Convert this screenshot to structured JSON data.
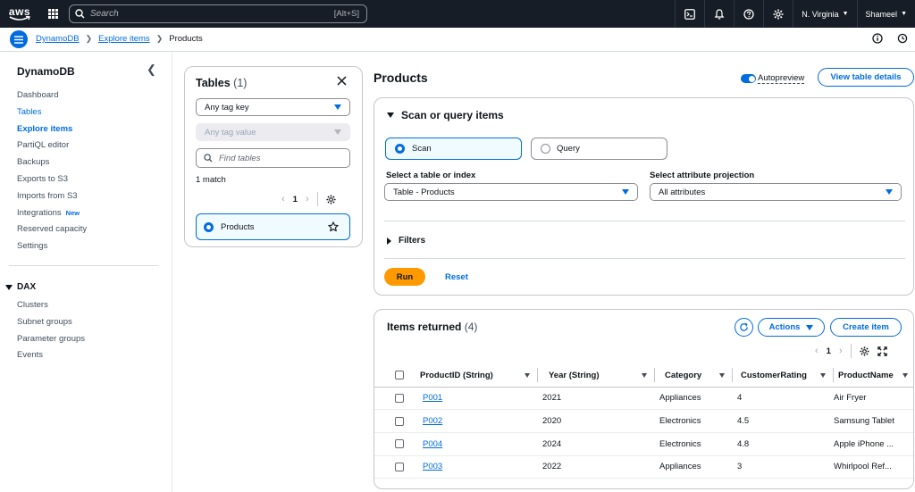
{
  "topnav": {
    "logo_text": "aws",
    "search_placeholder": "Search",
    "search_shortcut": "[Alt+S]",
    "region": "N. Virginia",
    "user": "Shameel"
  },
  "breadcrumb": {
    "items": [
      "DynamoDB",
      "Explore items"
    ],
    "current": "Products"
  },
  "sidebar": {
    "title": "DynamoDB",
    "items": [
      {
        "label": "Dashboard"
      },
      {
        "label": "Tables"
      },
      {
        "label": "Explore items"
      },
      {
        "label": "PartiQL editor"
      },
      {
        "label": "Backups"
      },
      {
        "label": "Exports to S3"
      },
      {
        "label": "Imports from S3"
      },
      {
        "label": "Integrations",
        "badge": "New"
      },
      {
        "label": "Reserved capacity"
      },
      {
        "label": "Settings"
      }
    ],
    "dax_title": "DAX",
    "dax_items": [
      "Clusters",
      "Subnet groups",
      "Parameter groups",
      "Events"
    ]
  },
  "tables_panel": {
    "title": "Tables",
    "count": "(1)",
    "tag_key": "Any tag key",
    "tag_value": "Any tag value",
    "find_placeholder": "Find tables",
    "match": "1 match",
    "page": "1",
    "table_name": "Products"
  },
  "main": {
    "title": "Products",
    "autopreview": "Autopreview",
    "view_details": "View table details"
  },
  "scan": {
    "title": "Scan or query items",
    "scan_label": "Scan",
    "query_label": "Query",
    "table_label": "Select a table or index",
    "table_value": "Table - Products",
    "projection_label": "Select attribute projection",
    "projection_value": "All attributes",
    "filters": "Filters",
    "run": "Run",
    "reset": "Reset"
  },
  "items": {
    "title": "Items returned",
    "count": "(4)",
    "actions": "Actions",
    "create": "Create item",
    "page": "1",
    "columns": [
      "ProductID (String)",
      "Year (String)",
      "Category",
      "CustomerRating",
      "ProductName"
    ],
    "rows": [
      [
        "P001",
        "2021",
        "Appliances",
        "4",
        "Air Fryer"
      ],
      [
        "P002",
        "2020",
        "Electronics",
        "4.5",
        "Samsung Tablet"
      ],
      [
        "P004",
        "2024",
        "Electronics",
        "4.8",
        "Apple iPhone ..."
      ],
      [
        "P003",
        "2022",
        "Appliances",
        "3",
        "Whirlpool Ref..."
      ]
    ]
  }
}
